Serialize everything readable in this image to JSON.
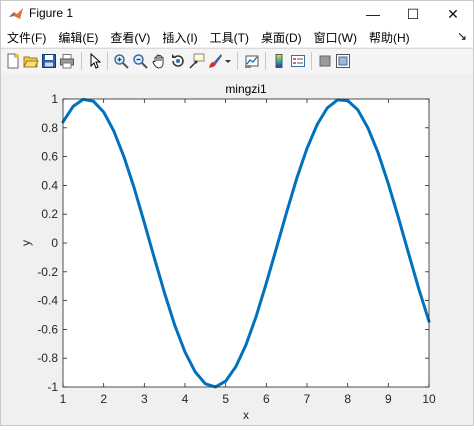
{
  "window": {
    "title": "Figure 1"
  },
  "controls": {
    "minimize": "—",
    "maximize": "☐",
    "close": "✕"
  },
  "menu": [
    "文件(F)",
    "编辑(E)",
    "查看(V)",
    "插入(I)",
    "工具(T)",
    "桌面(D)",
    "窗口(W)",
    "帮助(H)"
  ],
  "menu_dock_arrow": "↘",
  "toolbar_icons": [
    "new-figure-icon",
    "open-file-icon",
    "save-icon",
    "print-icon",
    "pointer-icon",
    "zoom-in-icon",
    "zoom-out-icon",
    "pan-icon",
    "rotate-icon",
    "data-cursor-icon",
    "brush-icon",
    "brush-dropdown-icon",
    "link-plot-icon",
    "colorbar-icon",
    "legend-icon",
    "hide-plot-tools-icon",
    "show-plot-tools-icon"
  ],
  "colors": {
    "line": "#0072bd",
    "axes_bg": "#ffffff",
    "figure_bg": "#f0f0f0"
  },
  "chart_data": {
    "type": "line",
    "title": "mingzi1",
    "xlabel": "x",
    "ylabel": "y",
    "xlim": [
      1,
      10
    ],
    "ylim": [
      -1,
      1
    ],
    "xticks": [
      "1",
      "2",
      "3",
      "4",
      "5",
      "6",
      "7",
      "8",
      "9",
      "10"
    ],
    "yticks": [
      "-1",
      "-0.8",
      "-0.6",
      "-0.4",
      "-0.2",
      "0",
      "0.2",
      "0.4",
      "0.6",
      "0.8",
      "1"
    ],
    "grid": false,
    "series": [
      {
        "x": [
          1,
          1.25,
          1.5,
          1.75,
          2,
          2.25,
          2.5,
          2.75,
          3,
          3.25,
          3.5,
          3.75,
          4,
          4.25,
          4.5,
          4.75,
          5,
          5.25,
          5.5,
          5.75,
          6,
          6.25,
          6.5,
          6.75,
          7,
          7.25,
          7.5,
          7.75,
          8,
          8.25,
          8.5,
          8.75,
          9,
          9.25,
          9.5,
          9.75,
          10
        ],
        "y": [
          0.841,
          0.949,
          0.997,
          0.984,
          0.909,
          0.778,
          0.598,
          0.382,
          0.141,
          -0.108,
          -0.351,
          -0.572,
          -0.757,
          -0.895,
          -0.978,
          -0.999,
          -0.959,
          -0.859,
          -0.706,
          -0.508,
          -0.279,
          -0.033,
          0.215,
          0.45,
          0.657,
          0.823,
          0.938,
          0.994,
          0.989,
          0.925,
          0.798,
          0.624,
          0.412,
          0.174,
          -0.075,
          -0.319,
          -0.544
        ]
      }
    ]
  }
}
